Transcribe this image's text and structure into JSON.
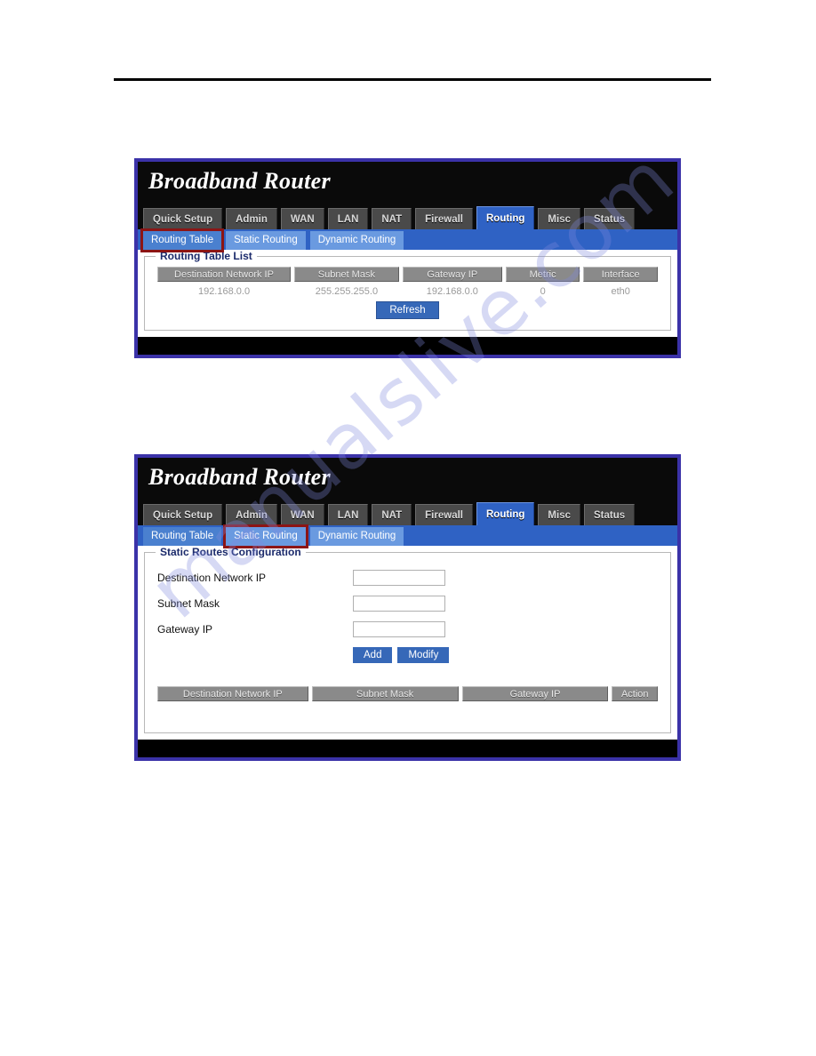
{
  "page": {
    "watermark": "manualslive.com"
  },
  "panel1": {
    "brand": "Broadband Router",
    "tabs": [
      {
        "label": "Quick Setup",
        "active": false
      },
      {
        "label": "Admin",
        "active": false
      },
      {
        "label": "WAN",
        "active": false
      },
      {
        "label": "LAN",
        "active": false
      },
      {
        "label": "NAT",
        "active": false
      },
      {
        "label": "Firewall",
        "active": false
      },
      {
        "label": "Routing",
        "active": true
      },
      {
        "label": "Misc",
        "active": false
      },
      {
        "label": "Status",
        "active": false
      }
    ],
    "subtabs": [
      {
        "label": "Routing Table",
        "active": true,
        "highlighted": true
      },
      {
        "label": "Static Routing",
        "active": false,
        "highlighted": false
      },
      {
        "label": "Dynamic Routing",
        "active": false,
        "highlighted": false
      }
    ],
    "legend": "Routing Table List",
    "table": {
      "columns": [
        "Destination Network IP",
        "Subnet Mask",
        "Gateway IP",
        "Metric",
        "Interface"
      ],
      "rows": [
        [
          "192.168.0.0",
          "255.255.255.0",
          "192.168.0.0",
          "0",
          "eth0"
        ]
      ]
    },
    "refresh_button": "Refresh"
  },
  "panel2": {
    "brand": "Broadband Router",
    "tabs": [
      {
        "label": "Quick Setup",
        "active": false
      },
      {
        "label": "Admin",
        "active": false
      },
      {
        "label": "WAN",
        "active": false
      },
      {
        "label": "LAN",
        "active": false
      },
      {
        "label": "NAT",
        "active": false
      },
      {
        "label": "Firewall",
        "active": false
      },
      {
        "label": "Routing",
        "active": true
      },
      {
        "label": "Misc",
        "active": false
      },
      {
        "label": "Status",
        "active": false
      }
    ],
    "subtabs": [
      {
        "label": "Routing Table",
        "active": false,
        "highlighted": false
      },
      {
        "label": "Static Routing",
        "active": true,
        "highlighted": true
      },
      {
        "label": "Dynamic Routing",
        "active": false,
        "highlighted": false
      }
    ],
    "legend": "Static Routes Configuration",
    "fields": [
      {
        "label": "Destination Network IP",
        "value": "",
        "placeholder": ""
      },
      {
        "label": "Subnet Mask",
        "value": "",
        "placeholder": ""
      },
      {
        "label": "Gateway IP",
        "value": "",
        "placeholder": ""
      }
    ],
    "buttons": [
      {
        "label": "Add"
      },
      {
        "label": "Modify"
      }
    ],
    "table": {
      "columns": [
        "Destination Network IP",
        "Subnet Mask",
        "Gateway IP",
        "Action"
      ],
      "rows": []
    }
  },
  "colors": {
    "window_border": "#3b32a8",
    "tab_active": "#2f62c4",
    "subtab_bar": "#2f62c4",
    "subtab": "#6a9ae0",
    "highlight_box": "#8c1515",
    "button": "#3668b8",
    "legend_text": "#1b2a6b",
    "table_header": "#8a8a8a"
  }
}
